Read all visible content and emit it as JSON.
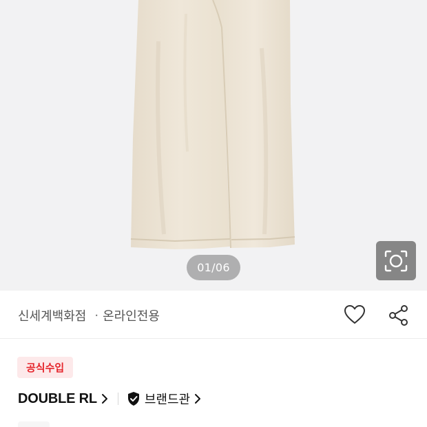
{
  "gallery": {
    "page_indicator": "01/06",
    "product_color": "#eee5d6",
    "lens_icon": "image-search-icon"
  },
  "info": {
    "seller": "신세계백화점",
    "seller_tag": "온라인전용",
    "like_icon": "heart-icon",
    "share_icon": "share-icon"
  },
  "badge": {
    "label": "공식수입",
    "color": "#e5242b",
    "background": "#fde9ea"
  },
  "brand": {
    "name": "DOUBLE RL",
    "brandhall_label": "브랜드관",
    "brandhall_icon": "shield-check-icon"
  }
}
